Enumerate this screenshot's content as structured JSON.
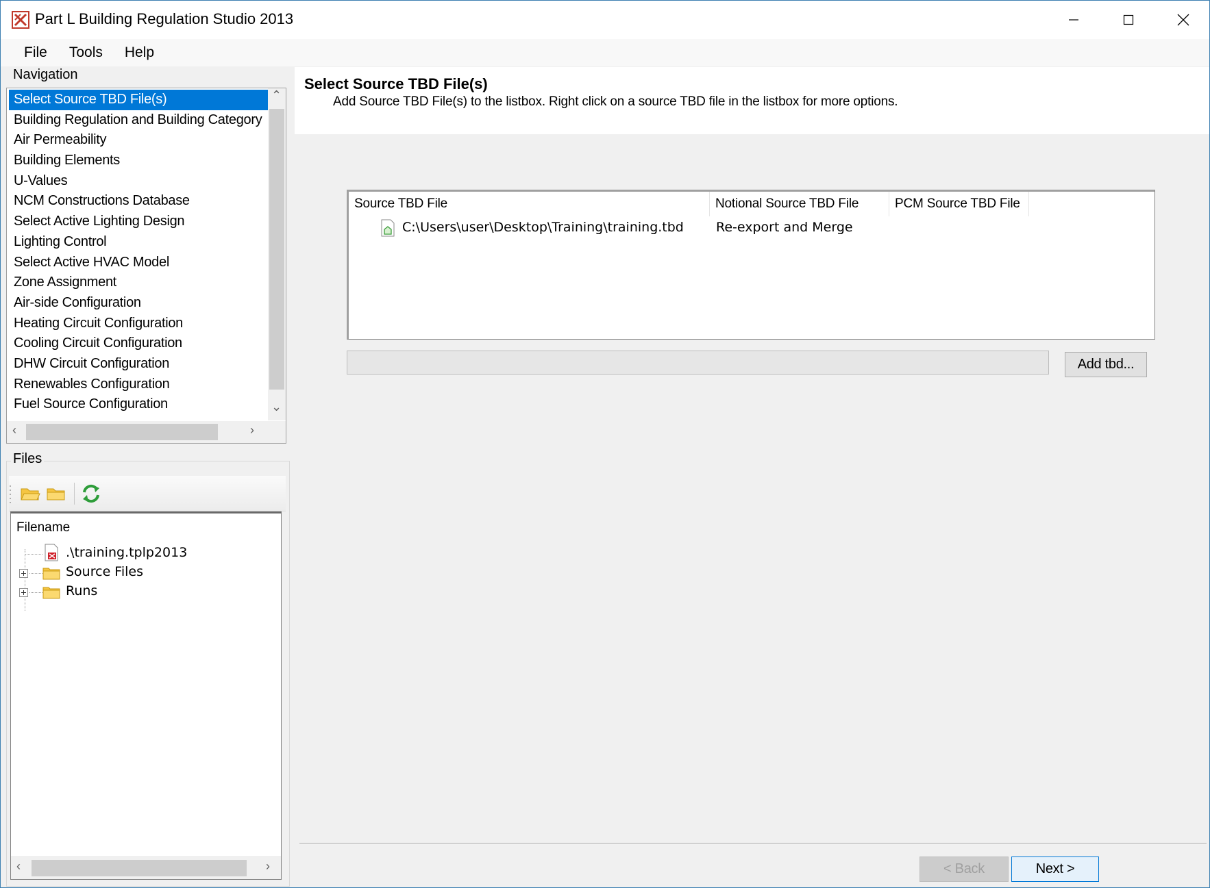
{
  "window": {
    "title": "Part L Building Regulation Studio 2013"
  },
  "menu": [
    "File",
    "Tools",
    "Help"
  ],
  "navigation": {
    "label": "Navigation",
    "items": [
      "Select Source TBD File(s)",
      "Building Regulation and Building Category",
      "Air Permeability",
      "Building Elements",
      "U-Values",
      "NCM Constructions Database",
      "Select Active Lighting Design",
      "Lighting Control",
      "Select Active HVAC Model",
      "Zone Assignment",
      "Air-side Configuration",
      "Heating Circuit Configuration",
      "Cooling Circuit Configuration",
      "DHW Circuit Configuration",
      "Renewables Configuration",
      "Fuel Source Configuration"
    ],
    "selected_index": 0
  },
  "files": {
    "label": "Files",
    "toolbar_icons": [
      "open-folder-icon",
      "folder-icon",
      "refresh-icon"
    ],
    "column": "Filename",
    "tree": [
      {
        "label": ".\\training.tplp2013",
        "icon": "project-file-icon",
        "expandable": false
      },
      {
        "label": "Source Files",
        "icon": "folder-icon",
        "expandable": true
      },
      {
        "label": "Runs",
        "icon": "folder-icon",
        "expandable": true
      }
    ]
  },
  "page": {
    "title": "Select Source TBD File(s)",
    "description": "Add Source TBD File(s) to the listbox. Right click on a source TBD file in the listbox for more options."
  },
  "listview": {
    "columns": [
      "Source TBD File",
      "Notional Source TBD File",
      "PCM Source TBD File"
    ],
    "rows": [
      {
        "source": "C:\\Users\\user\\Desktop\\Training\\training.tbd",
        "notional": "Re-export and Merge",
        "pcm": ""
      }
    ]
  },
  "buttons": {
    "add": "Add tbd...",
    "back": "< Back",
    "next": "Next >"
  },
  "colors": {
    "selection": "#0078d7",
    "window_border": "#3c7fb1",
    "folder": "#f5c542"
  }
}
